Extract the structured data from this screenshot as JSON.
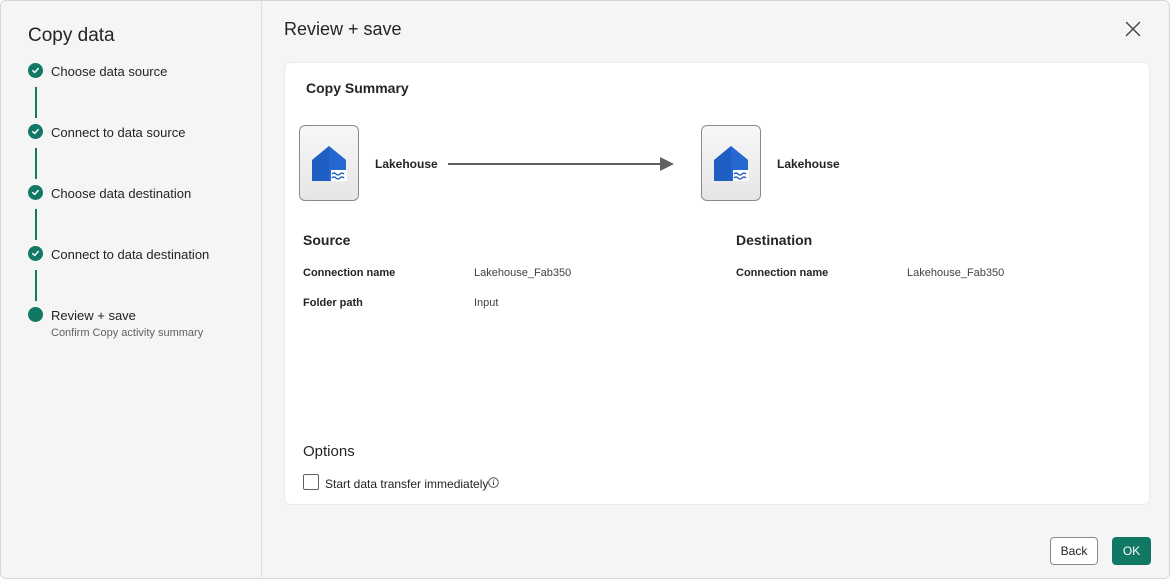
{
  "sidebar": {
    "title": "Copy data",
    "steps": [
      {
        "label": "Choose data source",
        "status": "completed"
      },
      {
        "label": "Connect to data source",
        "status": "completed"
      },
      {
        "label": "Choose data destination",
        "status": "completed"
      },
      {
        "label": "Connect to data destination",
        "status": "completed"
      },
      {
        "label": "Review + save",
        "subtitle": "Confirm Copy activity summary",
        "status": "current"
      }
    ]
  },
  "main": {
    "title": "Review + save",
    "summary": {
      "title": "Copy Summary",
      "source_tile_label": "Lakehouse",
      "destination_tile_label": "Lakehouse",
      "source": {
        "heading": "Source",
        "connection_name_key": "Connection name",
        "connection_name_value": "Lakehouse_Fab350",
        "folder_path_key": "Folder path",
        "folder_path_value": "Input"
      },
      "destination": {
        "heading": "Destination",
        "connection_name_key": "Connection name",
        "connection_name_value": "Lakehouse_Fab350"
      },
      "options": {
        "heading": "Options",
        "start_transfer_label": "Start data transfer immediately",
        "start_transfer_checked": false
      }
    }
  },
  "footer": {
    "back_label": "Back",
    "ok_label": "OK"
  },
  "colors": {
    "accent": "#117865",
    "lakehouse_icon": "#1f5fc4"
  },
  "icons": {
    "step_completed": "checkmark-circle-icon",
    "close": "close-icon",
    "lakehouse": "lakehouse-icon",
    "info": "info-icon",
    "arrow": "arrow-right-icon"
  }
}
